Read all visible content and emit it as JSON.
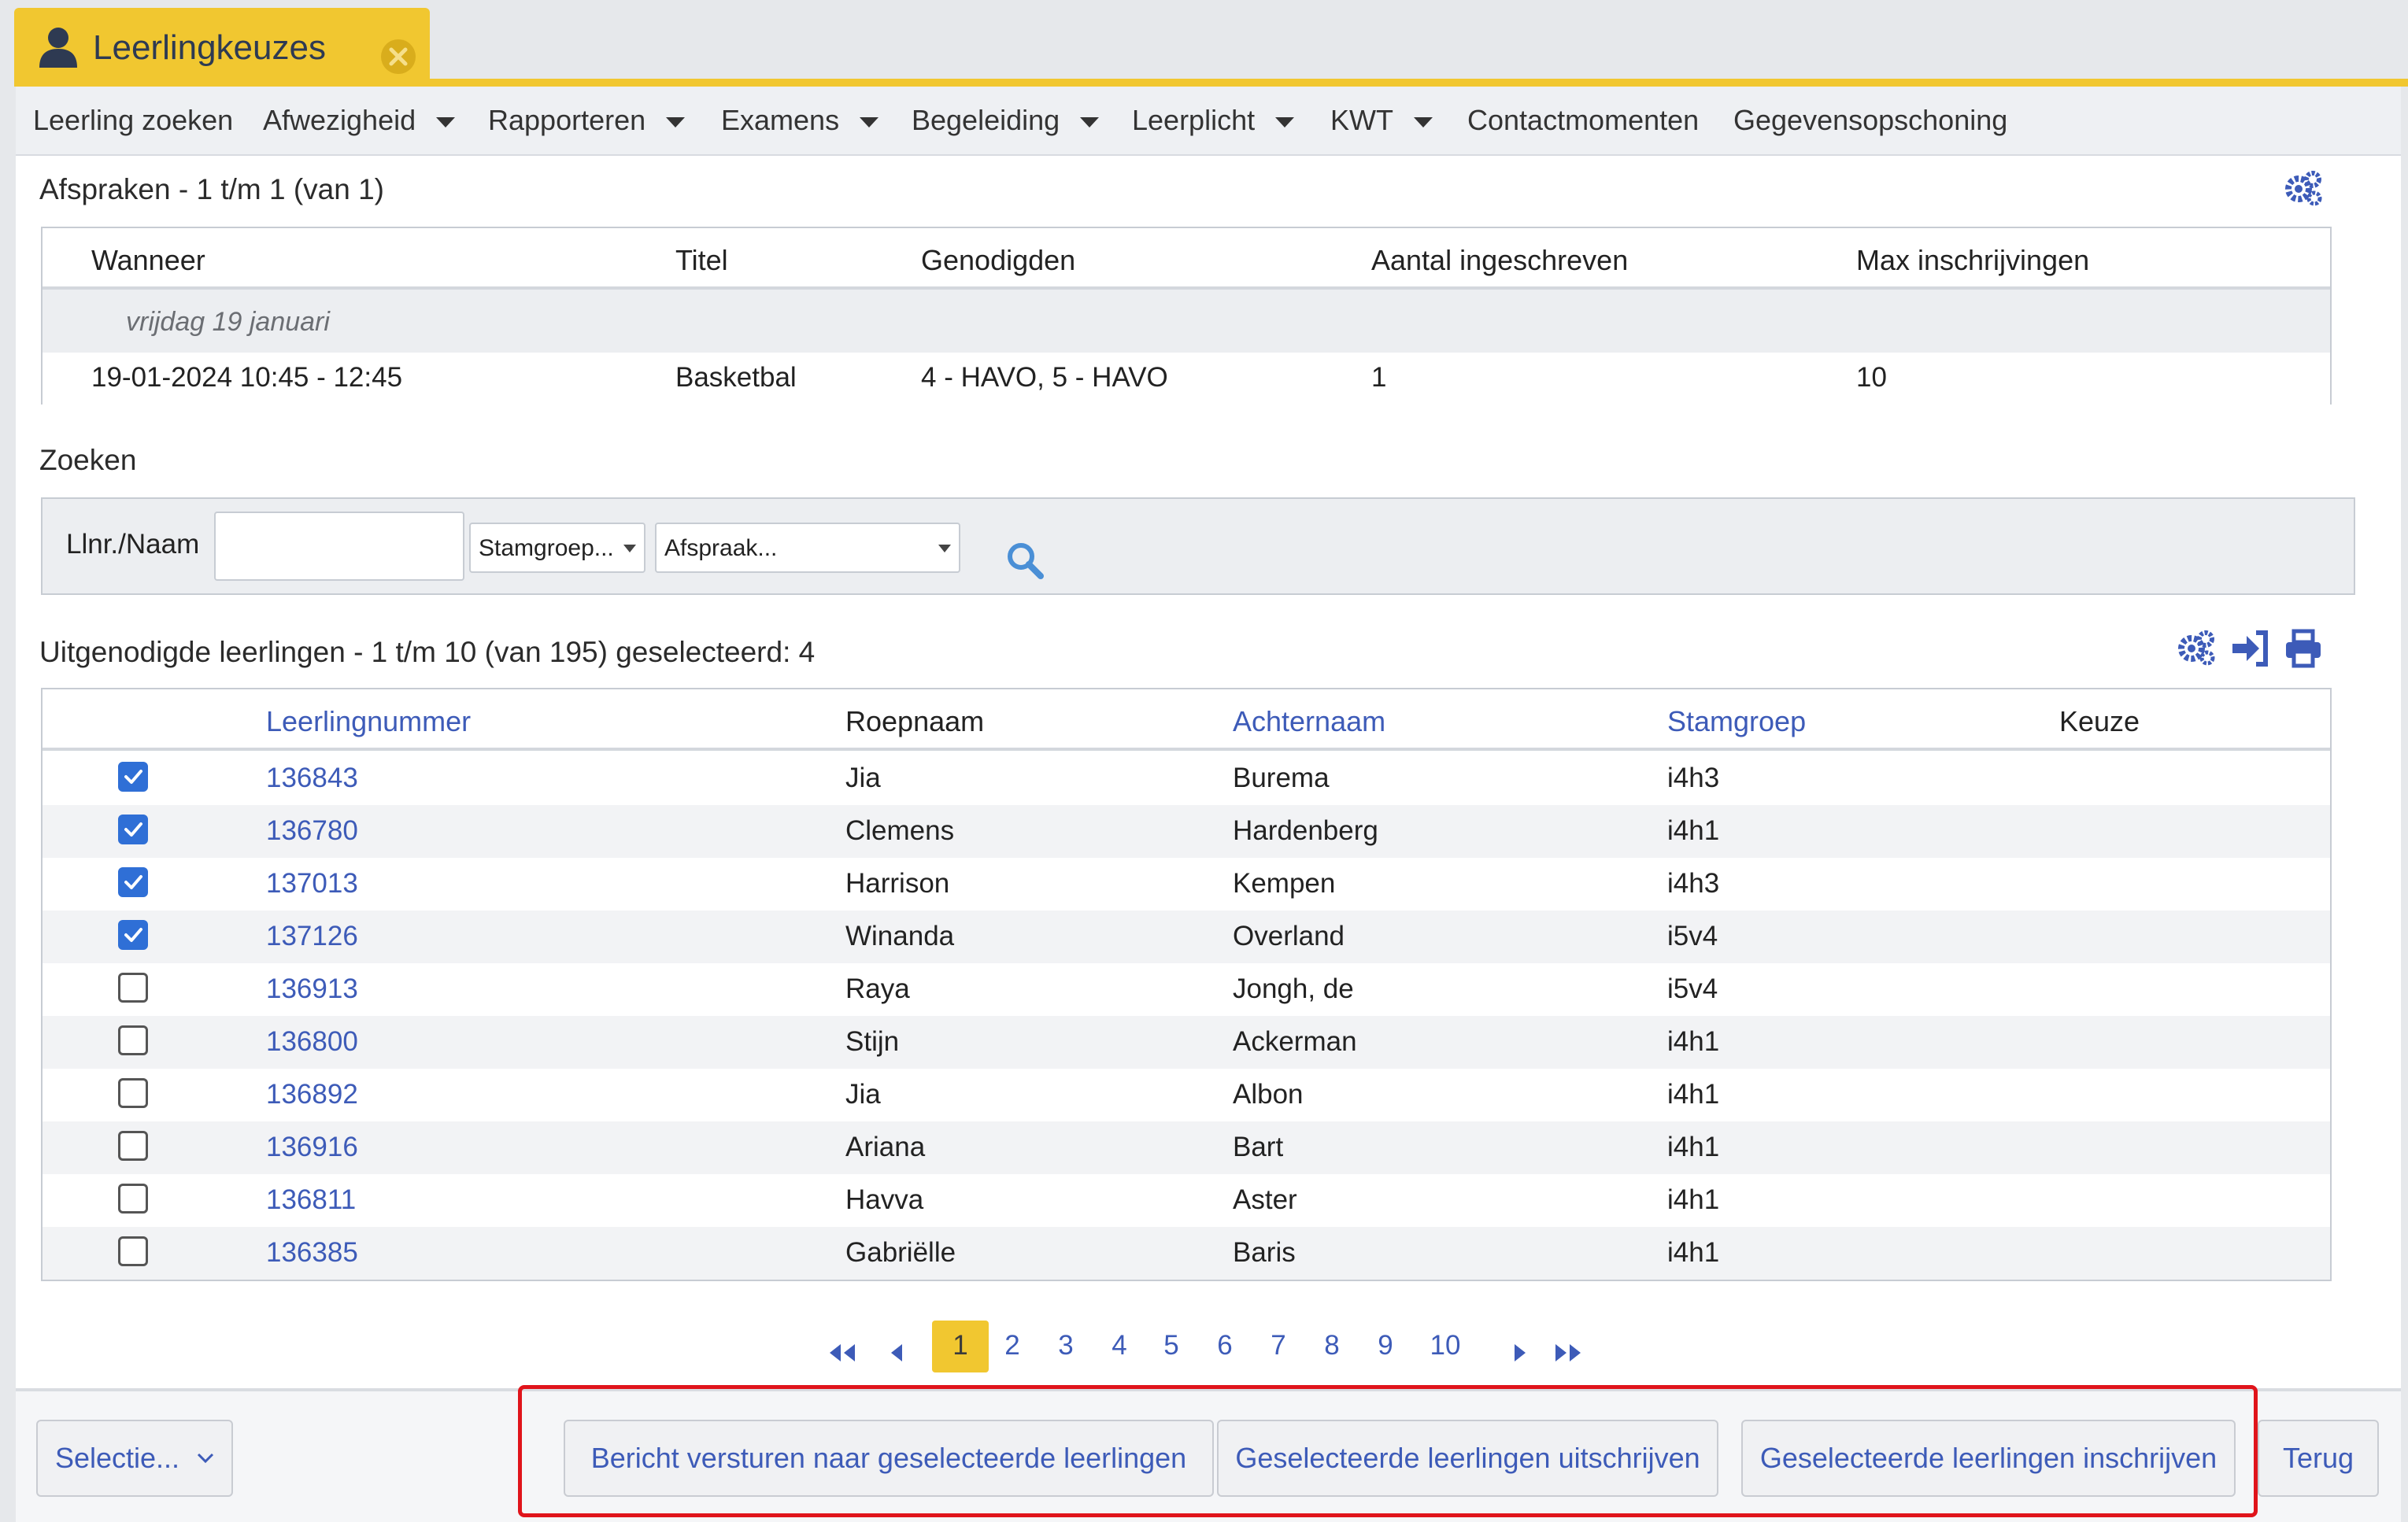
{
  "tab": {
    "title": "Leerlingkeuzes",
    "icon": "user-icon",
    "close_icon": "close-circle-icon"
  },
  "menu": [
    {
      "label": "Leerling zoeken",
      "dropdown": false
    },
    {
      "label": "Afwezigheid",
      "dropdown": true
    },
    {
      "label": "Rapporteren",
      "dropdown": true
    },
    {
      "label": "Examens",
      "dropdown": true
    },
    {
      "label": "Begeleiding",
      "dropdown": true
    },
    {
      "label": "Leerplicht",
      "dropdown": true
    },
    {
      "label": "KWT",
      "dropdown": true
    },
    {
      "label": "Contactmomenten",
      "dropdown": false
    },
    {
      "label": "Gegevensopschoning",
      "dropdown": false
    }
  ],
  "afspraken": {
    "title": "Afspraken - 1 t/m 1 (van 1)",
    "columns": [
      "Wanneer",
      "Titel",
      "Genodigden",
      "Aantal ingeschreven",
      "Max inschrijvingen"
    ],
    "group_label": "vrijdag 19 januari",
    "row": [
      "19-01-2024 10:45 - 12:45",
      "Basketbal",
      "4 - HAVO, 5 - HAVO",
      "1",
      "10"
    ]
  },
  "zoeken": {
    "title": "Zoeken",
    "label": "Llnr./Naam",
    "input_value": "",
    "stamgroep_select": "Stamgroep...",
    "afspraak_select": "Afspraak..."
  },
  "leerlingen": {
    "title": "Uitgenodigde leerlingen - 1 t/m 10 (van 195) geselecteerd: 4",
    "columns": [
      "Leerlingnummer",
      "Roepnaam",
      "Achternaam",
      "Stamgroep",
      "Keuze"
    ],
    "rows": [
      {
        "checked": true,
        "nummer": "136843",
        "roepnaam": "Jia",
        "achternaam": "Burema",
        "stamgroep": "i4h3",
        "keuze": ""
      },
      {
        "checked": true,
        "nummer": "136780",
        "roepnaam": "Clemens",
        "achternaam": "Hardenberg",
        "stamgroep": "i4h1",
        "keuze": ""
      },
      {
        "checked": true,
        "nummer": "137013",
        "roepnaam": "Harrison",
        "achternaam": "Kempen",
        "stamgroep": "i4h3",
        "keuze": ""
      },
      {
        "checked": true,
        "nummer": "137126",
        "roepnaam": "Winanda",
        "achternaam": "Overland",
        "stamgroep": "i5v4",
        "keuze": ""
      },
      {
        "checked": false,
        "nummer": "136913",
        "roepnaam": "Raya",
        "achternaam": "Jongh, de",
        "stamgroep": "i5v4",
        "keuze": ""
      },
      {
        "checked": false,
        "nummer": "136800",
        "roepnaam": "Stijn",
        "achternaam": "Ackerman",
        "stamgroep": "i4h1",
        "keuze": ""
      },
      {
        "checked": false,
        "nummer": "136892",
        "roepnaam": "Jia",
        "achternaam": "Albon",
        "stamgroep": "i4h1",
        "keuze": ""
      },
      {
        "checked": false,
        "nummer": "136916",
        "roepnaam": "Ariana",
        "achternaam": "Bart",
        "stamgroep": "i4h1",
        "keuze": ""
      },
      {
        "checked": false,
        "nummer": "136811",
        "roepnaam": "Havva",
        "achternaam": "Aster",
        "stamgroep": "i4h1",
        "keuze": ""
      },
      {
        "checked": false,
        "nummer": "136385",
        "roepnaam": "Gabriëlle",
        "achternaam": "Baris",
        "stamgroep": "i4h1",
        "keuze": ""
      }
    ]
  },
  "pagination": {
    "pages": [
      "1",
      "2",
      "3",
      "4",
      "5",
      "6",
      "7",
      "8",
      "9",
      "10"
    ],
    "current": "1"
  },
  "footer": {
    "selectie": "Selectie...",
    "bericht": "Bericht versturen naar geselecteerde leerlingen",
    "uitschrijven": "Geselecteerde leerlingen uitschrijven",
    "inschrijven": "Geselecteerde leerlingen inschrijven",
    "terug": "Terug"
  },
  "colors": {
    "accent": "#f1c730",
    "link": "#3d5bb8",
    "checkbox": "#2f6fd6",
    "highlight": "#e0141b"
  }
}
